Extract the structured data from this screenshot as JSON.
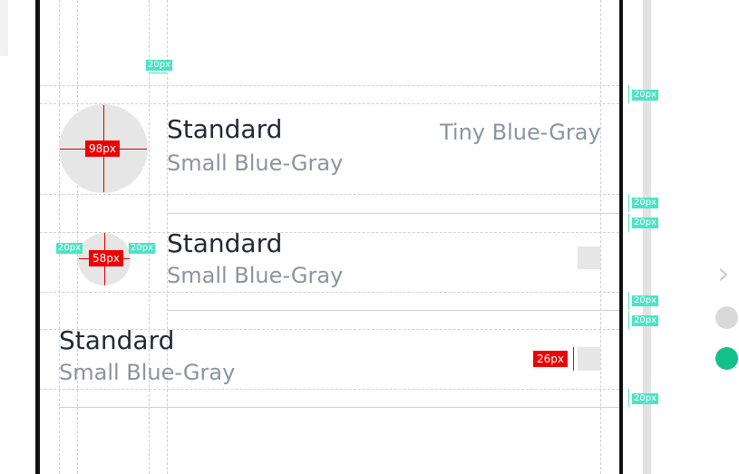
{
  "rows": [
    {
      "title": "Standard",
      "subtitle": "Small Blue-Gray",
      "trailing": "Tiny Blue-Gray"
    },
    {
      "title": "Standard",
      "subtitle": "Small Blue-Gray"
    },
    {
      "title": "Standard",
      "subtitle": "Small Blue-Gray"
    }
  ],
  "specs": {
    "avatar_large": "98px",
    "avatar_small": "58px",
    "box_size": "26px",
    "spacing": "20px"
  },
  "colors": {
    "title": "#1f2937",
    "subtitle": "#8a94a1",
    "placeholder": "#e6e6e6",
    "spec_red": "#ee0000",
    "spec_teal": "#4de3c4",
    "dot_inactive": "#d9d9d9",
    "dot_active": "#13c08a"
  },
  "icons": [
    "chevron-right-icon",
    "pagination-dot-icon"
  ]
}
